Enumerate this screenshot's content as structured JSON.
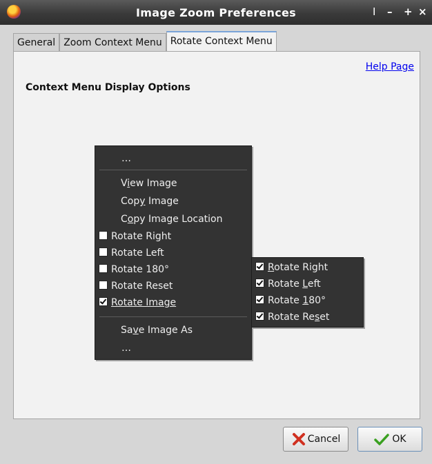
{
  "window": {
    "title": "Image Zoom Preferences",
    "controls": {
      "separator": "I",
      "minimize": "–",
      "maximize": "+",
      "close": "×"
    }
  },
  "tabs": [
    "General",
    "Zoom Context Menu",
    "Rotate Context Menu"
  ],
  "active_tab": "Rotate Context Menu",
  "panel": {
    "help_link": "Help Page",
    "section_title": "Context Menu Display Options"
  },
  "context_menu": {
    "top_ellipsis": "…",
    "view_image": {
      "pre": "V",
      "mn": "i",
      "post": "ew Image"
    },
    "copy_image": {
      "pre": "Cop",
      "mn": "y",
      "post": " Image"
    },
    "copy_image_location": {
      "pre": "C",
      "mn": "o",
      "post": "py Image Location"
    },
    "rotate_right": {
      "label": "Rotate Right",
      "checked": false
    },
    "rotate_left": {
      "label": "Rotate Left",
      "checked": false
    },
    "rotate_180": {
      "label": "Rotate 180°",
      "checked": false
    },
    "rotate_reset": {
      "label": "Rotate Reset",
      "checked": false
    },
    "rotate_image": {
      "label": "Rotate Image",
      "checked": true
    },
    "save_image_as": {
      "pre": "Sa",
      "mn": "v",
      "post": "e Image As"
    },
    "bottom_ellipsis": "…"
  },
  "submenu": {
    "rotate_right": {
      "mn": "R",
      "post": "otate Right",
      "checked": true
    },
    "rotate_left": {
      "pre": "Rotate ",
      "mn": "L",
      "post": "eft",
      "checked": true
    },
    "rotate_180": {
      "pre": "Rotate ",
      "mn": "1",
      "post": "80°",
      "checked": true
    },
    "rotate_reset": {
      "pre": "Rotate Re",
      "mn": "s",
      "post": "et",
      "checked": true
    }
  },
  "buttons": {
    "cancel": "Cancel",
    "ok": "OK"
  },
  "colors": {
    "menu_bg": "#333333",
    "link": "#0000ee",
    "cancel_icon": "#d03020",
    "ok_icon": "#3aa020"
  }
}
